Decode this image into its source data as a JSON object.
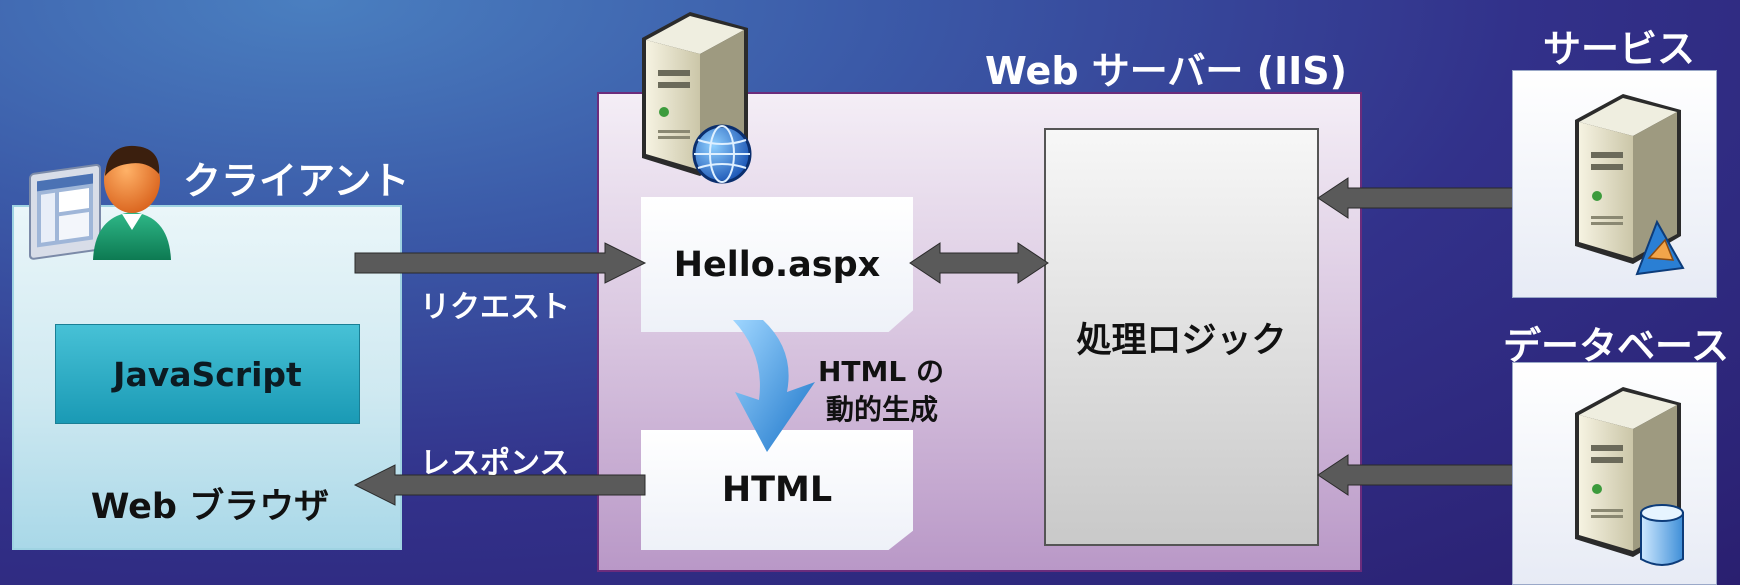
{
  "client": {
    "title": "クライアント",
    "javascript_label": "JavaScript",
    "browser_label": "Web ブラウザ"
  },
  "server": {
    "title": "Web サーバー (IIS)",
    "page_label": "Hello.aspx",
    "html_label": "HTML",
    "generation_label_1": "HTML の",
    "generation_label_2": "動的生成",
    "logic_label": "処理ロジック"
  },
  "flows": {
    "request_label": "リクエスト",
    "response_label": "レスポンス"
  },
  "services": {
    "service_title": "サービス",
    "database_title": "データベース"
  },
  "colors": {
    "server_border": "#6c2c7c",
    "javascript_fill": "#1a9ab5",
    "arrow_fill": "#5a5a5a",
    "generation_arrow": "#2a8fe0"
  },
  "icons": [
    "computer-screen-icon",
    "user-icon",
    "server-globe-icon",
    "server-service-icon",
    "server-database-icon"
  ]
}
